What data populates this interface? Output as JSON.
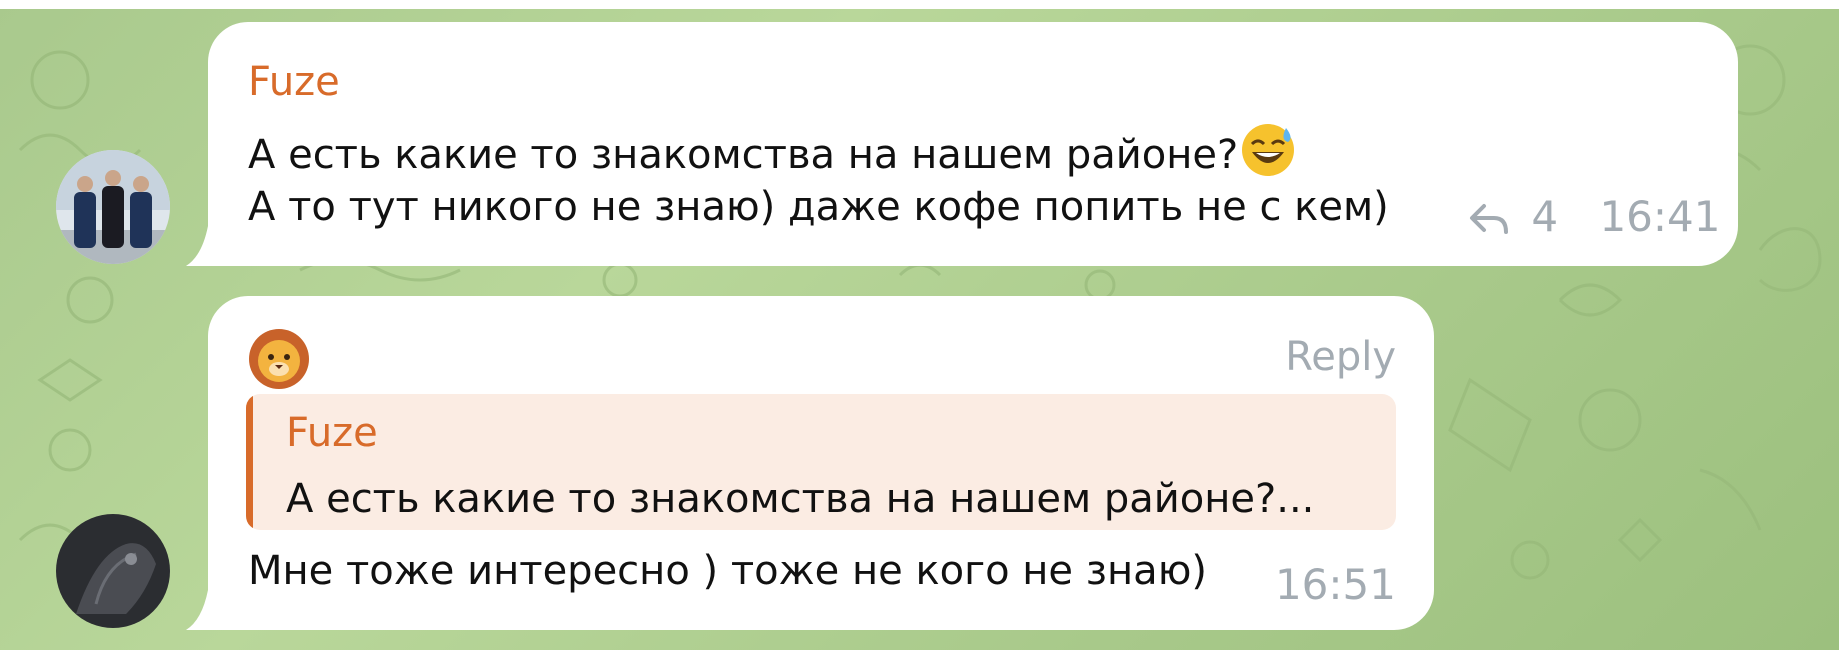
{
  "messages": [
    {
      "sender": "Fuze",
      "lines": [
        "А есть какие то знакомства на нашем районе?",
        "А то тут никого не знаю) даже кофе попить не с кем)"
      ],
      "emoji_icon": "grinning-sweat-emoji",
      "reply_count": "4",
      "time": "16:41",
      "avatar_icon": "group-photo-avatar"
    },
    {
      "sender_icon": "lion-emoji",
      "reply_label": "Reply",
      "quote": {
        "sender": "Fuze",
        "text": "А есть какие то знакомства на нашем районе?..."
      },
      "text": "Мне тоже интересно ) тоже не кого не знаю)",
      "time": "16:51",
      "avatar_icon": "dark-photo-avatar"
    }
  ],
  "colors": {
    "accent": "#d86b2a",
    "bubble": "#ffffff",
    "meta": "#a3abb2",
    "quote_bg": "#fbece3",
    "wallpaper": "#acca8e"
  }
}
